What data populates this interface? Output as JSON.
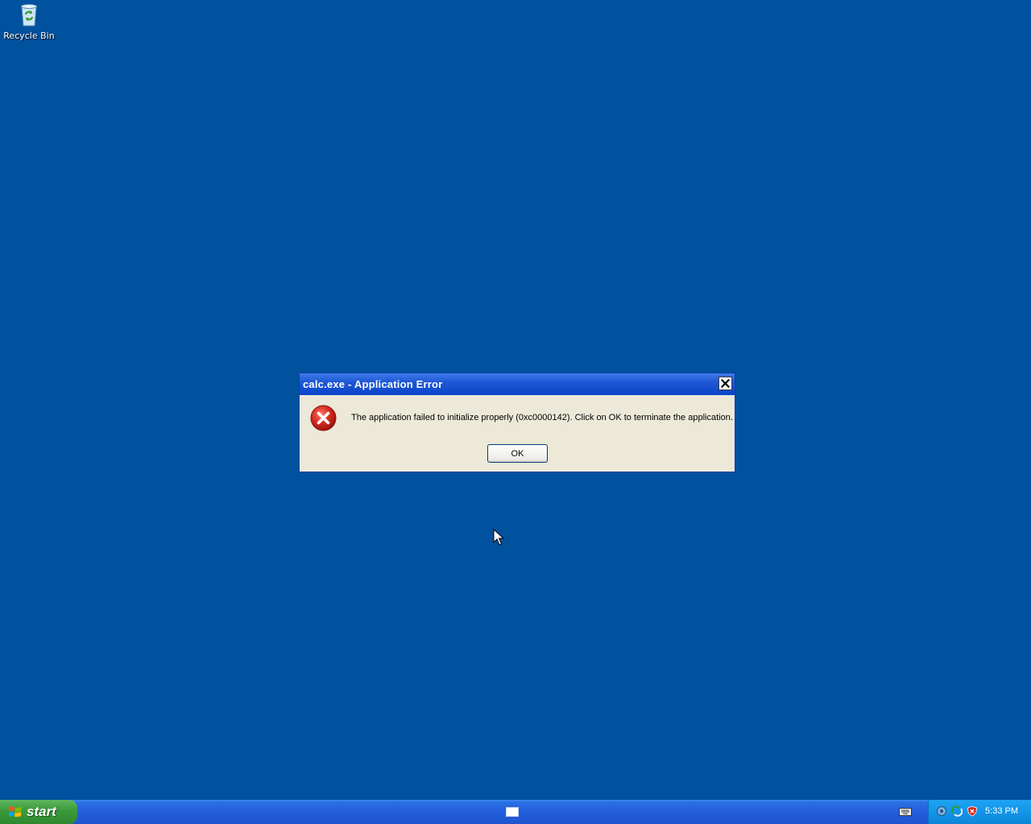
{
  "desktop": {
    "icons": [
      {
        "label": "Recycle Bin"
      }
    ]
  },
  "dialog": {
    "title": "calc.exe - Application Error",
    "message": "The application failed to initialize properly (0xc0000142). Click on OK to terminate the application.",
    "ok_label": "OK"
  },
  "taskbar": {
    "start_label": "start",
    "clock": "5:33 PM"
  },
  "colors": {
    "desktop_background": "#00519e",
    "titlebar": "#0a45c8",
    "dialog_body": "#ece9d8",
    "start_button": "#3a9a3a",
    "taskbar": "#245edb",
    "tray": "#1395e8",
    "error_red": "#d72a1f"
  }
}
